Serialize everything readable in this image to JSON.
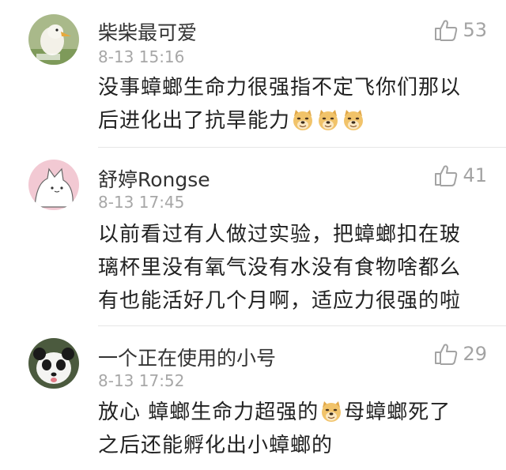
{
  "comments": [
    {
      "user": "柴柴最可爱",
      "time": "8-13 15:16",
      "likes": "53",
      "line1": "没事蟑螂生命力很强指不定飞你们那以",
      "line2": "后进化出了抗旱能力",
      "emojis": [
        "doge-emoji",
        "doge-emoji",
        "doge-emoji"
      ]
    },
    {
      "user": "舒婷Rongse",
      "time": "8-13 17:45",
      "likes": "41",
      "line1": "以前看过有人做过实验，把蟑螂扣在玻",
      "line2": "璃杯里没有氧气没有水没有食物啥都么",
      "line3": "有也能活好几个月啊，适应力很强的啦"
    },
    {
      "user": "一个正在使用的小号",
      "time": "8-13 17:52",
      "likes": "29",
      "line1a": "放心 蟑螂生命力超强的",
      "line1b": "母蟑螂死了",
      "line2": "之后还能孵化出小蟑螂的",
      "emojis": [
        "doge-emoji"
      ]
    }
  ],
  "colors": {
    "username": "#333333",
    "timestamp": "#a7a7a7",
    "likes": "#a3a3a3",
    "divider": "#e6e6e6"
  }
}
